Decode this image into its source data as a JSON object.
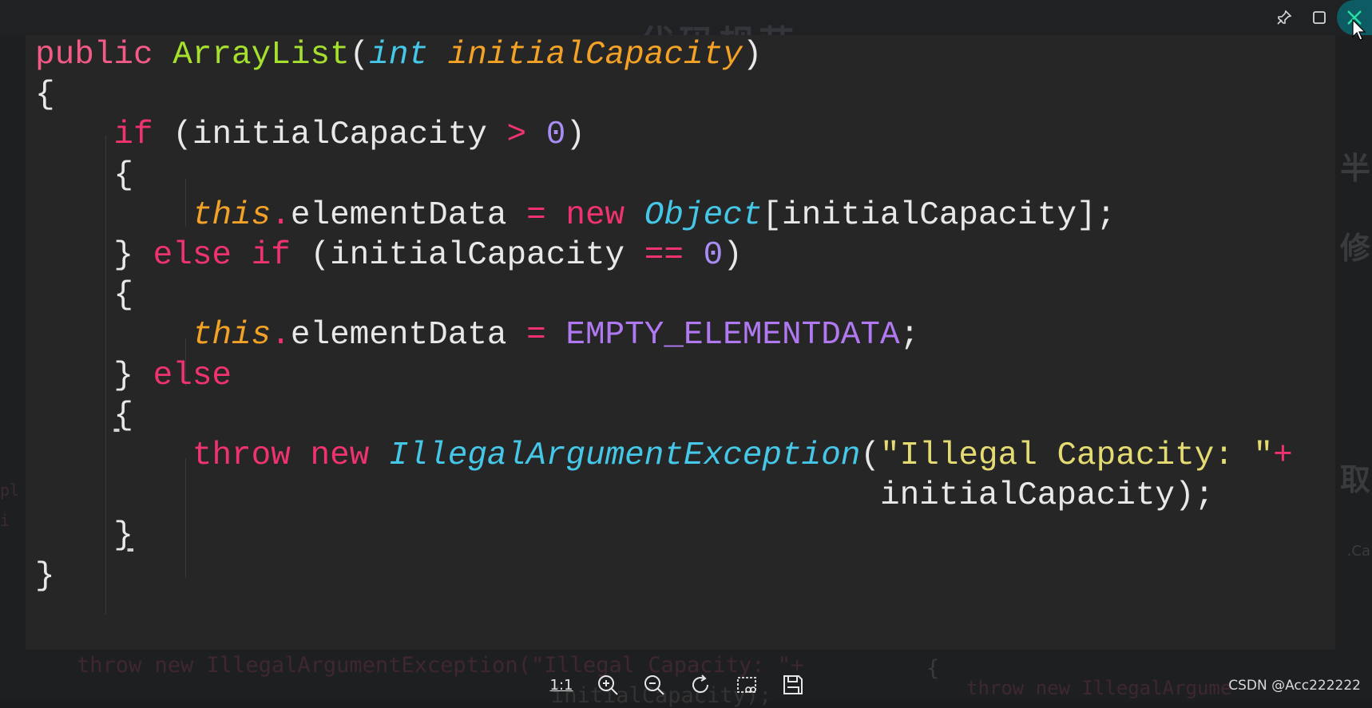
{
  "background": {
    "title_fragment": "代码规范",
    "right_fragments": [
      "半",
      "修",
      "取",
      ".Ca"
    ],
    "left_fragments": [
      "pl",
      "i"
    ],
    "ghost_code_line1": "throw new IllegalArgumentException(\"Illegal Capacity: \"+",
    "ghost_code_line2": "initialCapacity);",
    "ghost_code_line3": "throw new IllegalArgume",
    "ghost_brace": "{"
  },
  "code": {
    "lines": [
      "public ArrayList(int initialCapacity)",
      "{",
      "    if (initialCapacity > 0)",
      "    {",
      "        this.elementData = new Object[initialCapacity];",
      "    } else if (initialCapacity == 0)",
      "    {",
      "        this.elementData = EMPTY_ELEMENTDATA;",
      "    } else",
      "    {",
      "        throw new IllegalArgumentException(\"Illegal Capacity: \"+",
      "                                           initialCapacity);",
      "    }",
      "}"
    ]
  },
  "window_controls": {
    "pin_icon": "pin-icon",
    "maximize_icon": "maximize-icon",
    "close_icon": "close-icon"
  },
  "toolbar": {
    "actual_size_label": "1:1",
    "icons": [
      "zoom-in-icon",
      "zoom-out-icon",
      "rotate-icon",
      "crop-icon",
      "save-icon"
    ]
  },
  "watermark": "CSDN @Acc222222",
  "colors": {
    "keyword": "#f0336f",
    "function": "#a6e02e",
    "type": "#45c7e8",
    "parameter": "#f3a226",
    "number": "#a98df5",
    "constant": "#b079f2",
    "string": "#e5db73",
    "close_button": "#0e5c63"
  }
}
